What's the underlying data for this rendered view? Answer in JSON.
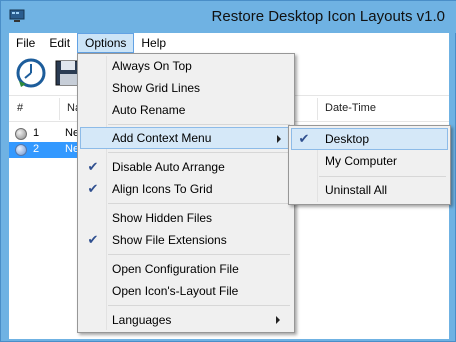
{
  "window": {
    "title": "Restore Desktop Icon Layouts v1.0",
    "app_icon": "monitor-icon"
  },
  "menubar": {
    "items": [
      "File",
      "Edit",
      "Options",
      "Help"
    ],
    "active": "Options"
  },
  "toolbar": {
    "buttons": [
      {
        "icon": "restore-clock-icon"
      },
      {
        "icon": "save-floppy-icon"
      }
    ]
  },
  "listview": {
    "columns": [
      "#",
      "Na",
      "Date-Time"
    ],
    "rows": [
      {
        "num": "1",
        "name": "Ne",
        "selected": false
      },
      {
        "num": "2",
        "name": "Ne",
        "selected": true
      }
    ]
  },
  "options_menu": {
    "items": [
      {
        "label": "Always On Top",
        "checked": false
      },
      {
        "label": "Show Grid Lines",
        "checked": false
      },
      {
        "label": "Auto Rename",
        "checked": false
      },
      {
        "label": "Add Context Menu",
        "checked": false,
        "submenu": true,
        "highlighted": true
      },
      {
        "label": "Disable Auto Arrange",
        "checked": true
      },
      {
        "label": "Align Icons To Grid",
        "checked": true
      },
      {
        "label": "Show Hidden Files",
        "checked": false
      },
      {
        "label": "Show File Extensions",
        "checked": true
      },
      {
        "label": "Open Configuration File",
        "checked": false
      },
      {
        "label": "Open Icon's-Layout File",
        "checked": false
      },
      {
        "label": "Languages",
        "checked": false,
        "submenu": true
      }
    ]
  },
  "context_submenu": {
    "items": [
      {
        "label": "Desktop",
        "checked": true,
        "highlighted": true
      },
      {
        "label": "My Computer",
        "checked": false
      },
      {
        "label": "Uninstall All",
        "checked": false
      }
    ]
  },
  "colors": {
    "titlebar": "#6fb2e3",
    "selection": "#3399ff",
    "menu_highlight": "#d5e8f8",
    "check": "#2f4f8f"
  }
}
